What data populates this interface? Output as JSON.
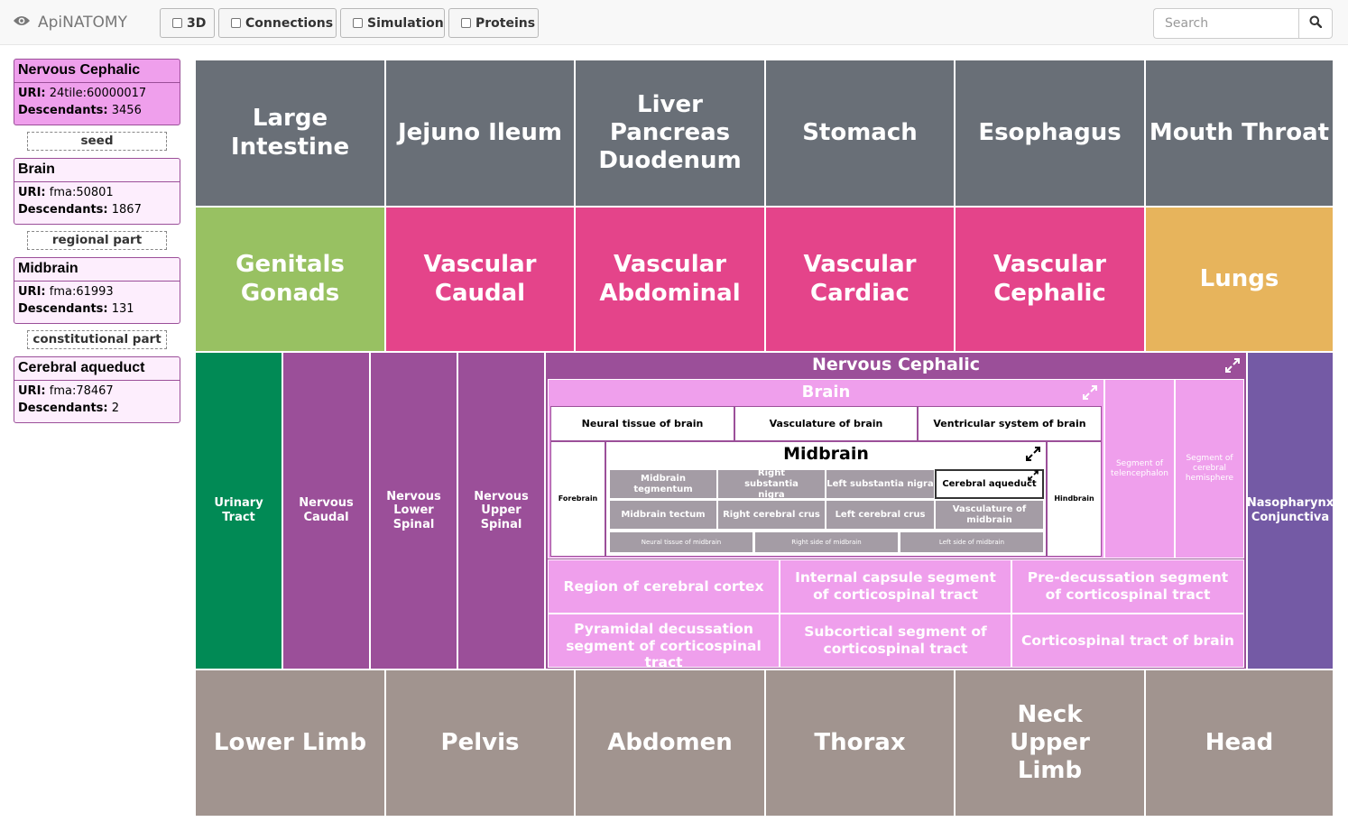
{
  "app": {
    "title": "ApiNATOMY"
  },
  "toolbar": {
    "toggle_3d": "3D",
    "toggle_connections": "Connections",
    "toggle_simulation": "Simulation",
    "toggle_proteins": "Proteins",
    "search_placeholder": "Search"
  },
  "sidebar": {
    "cards": [
      {
        "title": "Nervous Cephalic",
        "uri_label": "URI:",
        "uri": "24tile:60000017",
        "desc_label": "Descendants:",
        "descendants": "3456"
      },
      {
        "title": "Brain",
        "uri_label": "URI:",
        "uri": "fma:50801",
        "desc_label": "Descendants:",
        "descendants": "1867"
      },
      {
        "title": "Midbrain",
        "uri_label": "URI:",
        "uri": "fma:61993",
        "desc_label": "Descendants:",
        "descendants": "131"
      },
      {
        "title": "Cerebral aqueduct",
        "uri_label": "URI:",
        "uri": "fma:78467",
        "desc_label": "Descendants:",
        "descendants": "2"
      }
    ],
    "relations": [
      "seed",
      "regional part",
      "constitutional part"
    ]
  },
  "treemap": {
    "row1": [
      "Large Intestine",
      "Jejuno Ileum",
      "Liver Pancreas Duodenum",
      "Stomach",
      "Esophagus",
      "Mouth Throat"
    ],
    "row2": [
      "Genitals Gonads",
      "Vascular Caudal",
      "Vascular Abdominal",
      "Vascular Cardiac",
      "Vascular Cephalic",
      "Lungs"
    ],
    "row3_left": [
      "Urinary Tract",
      "Nervous Caudal",
      "Nervous Lower Spinal",
      "Nervous Upper Spinal"
    ],
    "row3_right": "Nasopharynx Conjunctiva",
    "row4": [
      "Lower Limb",
      "Pelvis",
      "Abdomen",
      "Thorax",
      "Neck Upper Limb",
      "Head"
    ],
    "nervous_cephalic": {
      "title": "Nervous Cephalic",
      "brain": {
        "title": "Brain",
        "top_parts": [
          "Neural tissue of brain",
          "Vasculature of brain",
          "Ventricular system of brain"
        ],
        "forebrain": "Forebrain",
        "hindbrain": "Hindbrain",
        "segments": [
          "Segment of telencephalon",
          "Segment of cerebral hemisphere"
        ],
        "midbrain": {
          "title": "Midbrain",
          "row1": [
            "Midbrain tegmentum",
            "Right substantia nigra",
            "Left substantia nigra",
            "Cerebral aqueduct"
          ],
          "row2": [
            "Midbrain tectum",
            "Right cerebral crus",
            "Left cerebral crus",
            "Vasculature of midbrain"
          ],
          "row3": [
            "Neural tissue of midbrain",
            "Right side of midbrain",
            "Left side of midbrain"
          ]
        }
      },
      "tracts": [
        "Region of cerebral cortex",
        "Internal capsule segment of corticospinal tract",
        "Pre-decussation segment of corticospinal tract",
        "Pyramidal decussation segment of corticospinal tract",
        "Subcortical segment of corticospinal tract",
        "Corticospinal tract of brain"
      ]
    }
  }
}
